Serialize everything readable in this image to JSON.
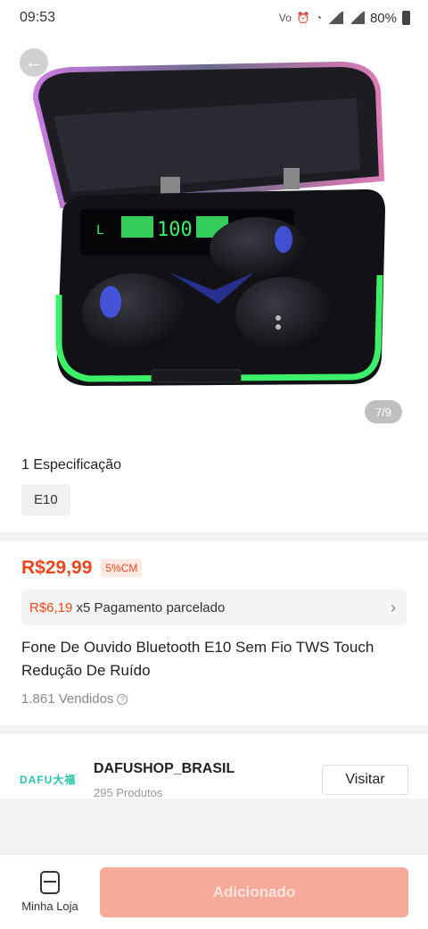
{
  "status_bar": {
    "time": "09:53",
    "battery": "80%"
  },
  "gallery": {
    "counter": "7/9",
    "back_icon": "arrow-left-icon"
  },
  "specs": {
    "title": "1 Especificação",
    "options": [
      "E10"
    ]
  },
  "pricing": {
    "price": "R$29,99",
    "cashback": "5%CM",
    "installment_amount": "R$6,19",
    "installment_text": "x5 Pagamento parcelado"
  },
  "product": {
    "title": "Fone De Ouvido Bluetooth E10 Sem Fio TWS Touch Redução De Ruído",
    "sold": "1.861 Vendidos"
  },
  "shop": {
    "logo_text": "DAFU大福",
    "name": "DAFUSHOP_BRASIL",
    "product_count": "295 Produtos",
    "visit_label": "Visitar"
  },
  "bottom_bar": {
    "store_label": "Minha Loja",
    "add_label": "Adicionado"
  },
  "colors": {
    "accent": "#e8471e",
    "button_disabled": "#f7a99a",
    "glow": "#3df06a"
  }
}
